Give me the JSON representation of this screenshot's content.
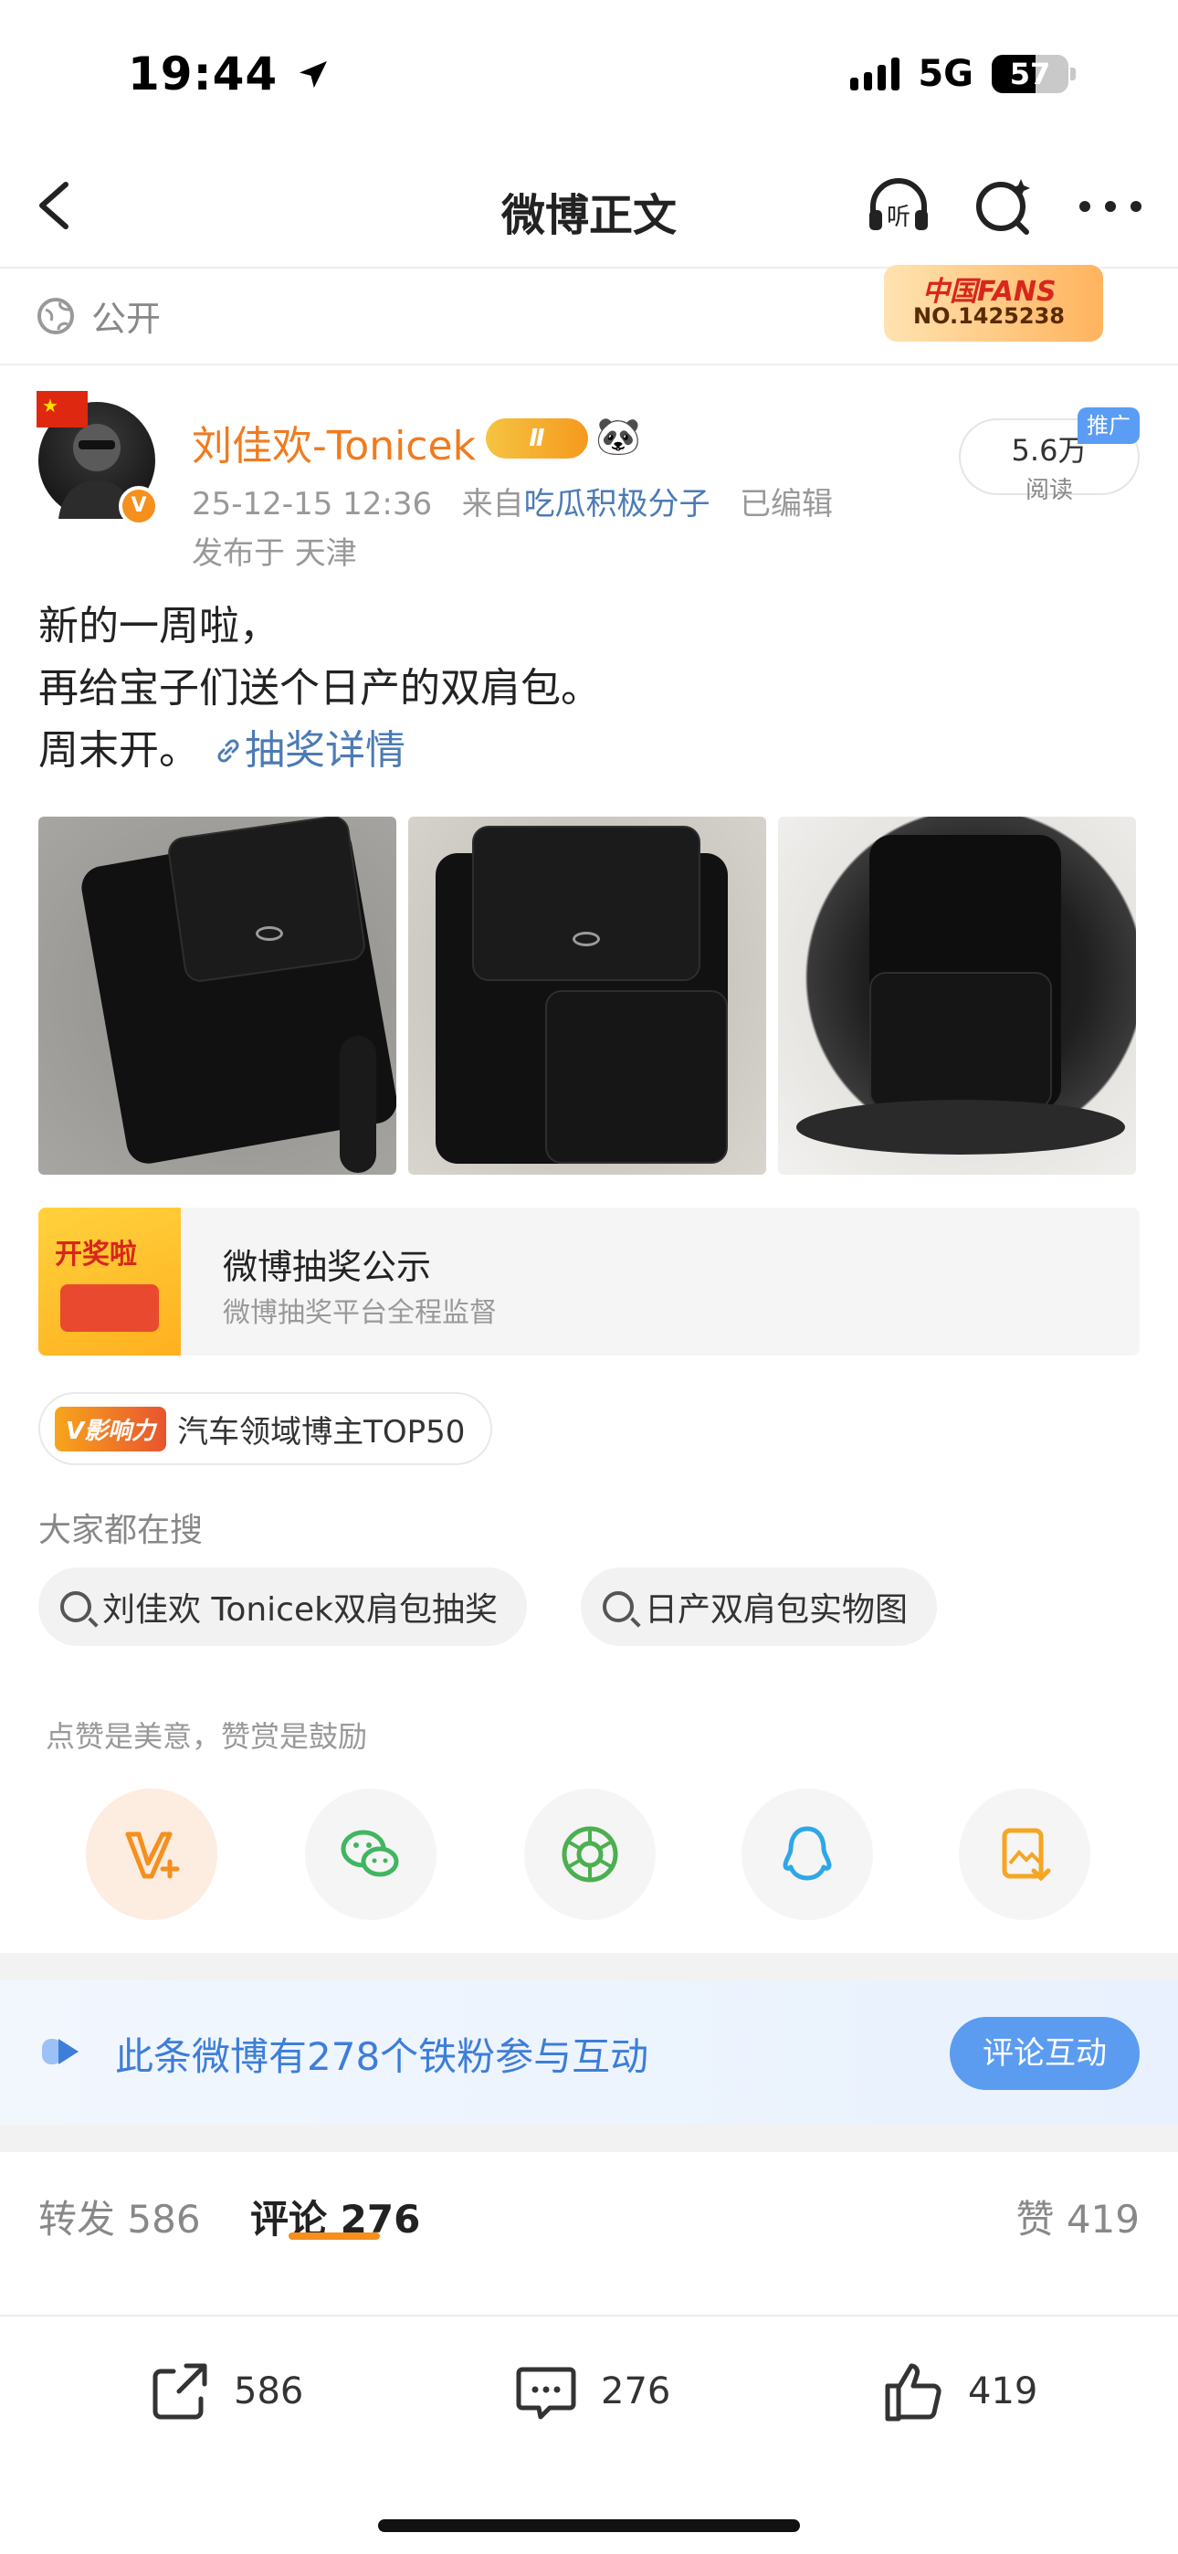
{
  "status_bar": {
    "time": "19:44",
    "network": "5G",
    "battery": "57"
  },
  "nav": {
    "title": "微博正文"
  },
  "visibility": {
    "label": "公开"
  },
  "fans_badge": {
    "line1": "中国FANS",
    "line2": "NO.1425238"
  },
  "author": {
    "name": "刘佳欢-Tonicek",
    "vip_level": "Ⅱ",
    "verified_mark": "V",
    "time": "25-12-15 12:36",
    "source_prefix": "来自",
    "source": "吃瓜积极分子",
    "edited": "已编辑",
    "location": "发布于 天津",
    "reads": "5.6万",
    "reads_label": "阅读",
    "promo_tag": "推广"
  },
  "post": {
    "line1": "新的一周啦，",
    "line2": "再给宝子们送个日产的双肩包。",
    "line3": "周末开。",
    "link": "抽奖详情"
  },
  "lottery_card": {
    "thumb_text": "开奖啦",
    "title": "微博抽奖公示",
    "subtitle": "微博抽奖平台全程监督"
  },
  "influence": {
    "badge": "V影响力",
    "text": "汽车领域博主TOP50"
  },
  "search": {
    "hint": "大家都在搜",
    "chips": [
      "刘佳欢 Tonicek双肩包抽奖",
      "日产双肩包实物图"
    ]
  },
  "reward_hint": "点赞是美意，赞赏是鼓励",
  "fans_interaction": {
    "text": "此条微博有278个铁粉参与互动",
    "button": "评论互动"
  },
  "tabs": {
    "repost_label": "转发",
    "repost_count": "586",
    "comment_label": "评论",
    "comment_count": "276",
    "like_label": "赞",
    "like_count": "419"
  },
  "bottom_bar": {
    "repost": "586",
    "comment": "276",
    "like": "419"
  },
  "colors": {
    "accent_orange": "#f58f1e",
    "link_blue": "#4c7bb5",
    "author_orange": "#f07b1f",
    "fans_blue": "#3d7ed8"
  }
}
